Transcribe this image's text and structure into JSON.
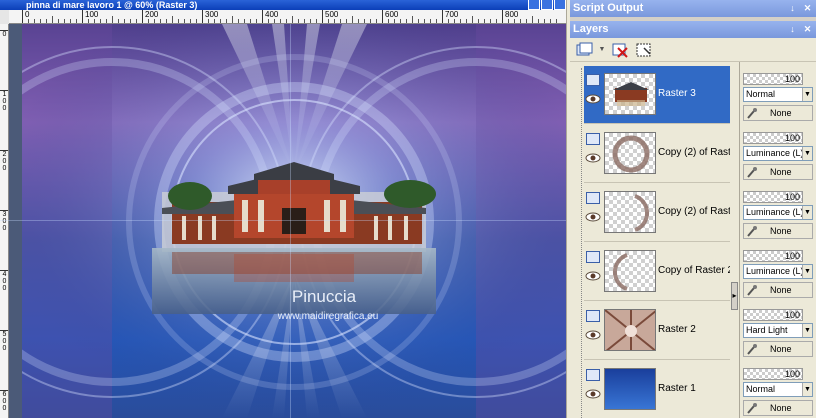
{
  "document": {
    "title": "pinna di mare lavoro 1 @ 60% (Raster 3)",
    "ruler_h_labels": [
      "0",
      "100",
      "200",
      "300",
      "400",
      "500",
      "600",
      "700",
      "800"
    ],
    "ruler_v_labels": [
      "0",
      "100",
      "200",
      "300",
      "400",
      "500",
      "600"
    ],
    "watermark_name": "Pinuccia",
    "watermark_url": "www.maidiregrafica.eu"
  },
  "script_output": {
    "title": "Script Output"
  },
  "layers_palette": {
    "title": "Layers",
    "toolbar": [
      {
        "icon": "new-layer-icon"
      },
      {
        "icon": "delete-layer-icon"
      },
      {
        "icon": "mask-layer-icon"
      }
    ],
    "layers": [
      {
        "name": "Raster 3",
        "opacity": "100",
        "blend": "Normal",
        "link": "None",
        "selected": true,
        "thumb": "temple"
      },
      {
        "name": "Copy (2) of Raster 2",
        "opacity": "100",
        "blend": "Luminance (L)",
        "link": "None",
        "selected": false,
        "thumb": "ring"
      },
      {
        "name": "Copy (2) of Raster 2",
        "opacity": "100",
        "blend": "Luminance (L)",
        "link": "None",
        "selected": false,
        "thumb": "arc-right"
      },
      {
        "name": "Copy of Raster 2",
        "opacity": "100",
        "blend": "Luminance (L)",
        "link": "None",
        "selected": false,
        "thumb": "arc-left"
      },
      {
        "name": "Raster 2",
        "opacity": "100",
        "blend": "Hard Light",
        "link": "None",
        "selected": false,
        "thumb": "rays"
      },
      {
        "name": "Raster 1",
        "opacity": "100",
        "blend": "Normal",
        "link": "None",
        "selected": false,
        "thumb": "gradient"
      }
    ]
  }
}
